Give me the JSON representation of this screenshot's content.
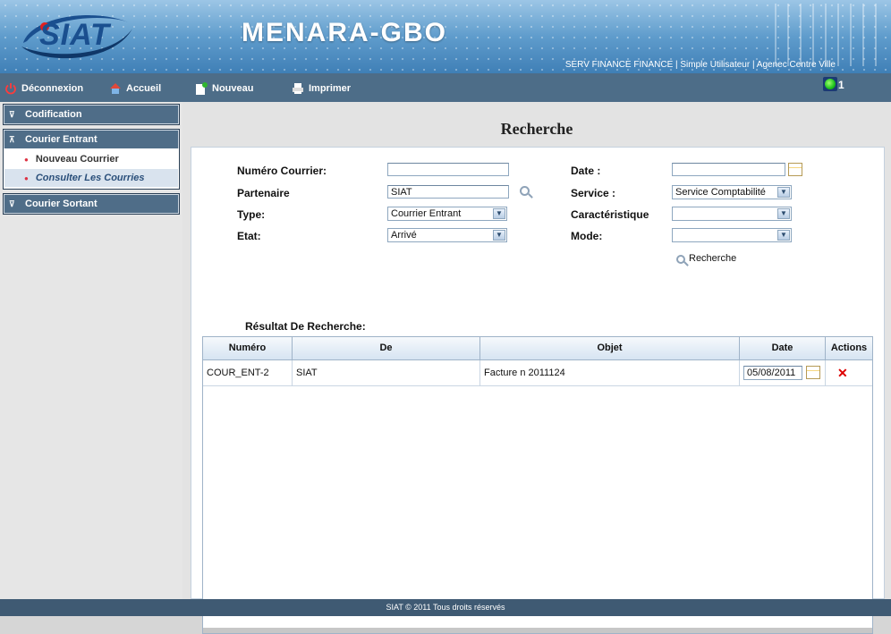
{
  "header": {
    "logo": "SIAT",
    "app_title": "MENARA-GBO",
    "user_info": "SERV FINANCE FINANCE | Simple Utilisateur | Agenec Centre Ville"
  },
  "toolbar": {
    "logout": "Déconnexion",
    "home": "Accueil",
    "new": "Nouveau",
    "print": "Imprimer",
    "notification_count": "1"
  },
  "sidebar": {
    "codification": "Codification",
    "courier_entrant": "Courier Entrant",
    "nouveau_courrier": "Nouveau Courrier",
    "consulter": "Consulter Les Courries",
    "courier_sortant": "Courier Sortant"
  },
  "main": {
    "title": "Recherche",
    "form": {
      "numero_label": "Numéro Courrier:",
      "numero_value": "",
      "partenaire_label": "Partenaire",
      "partenaire_value": "SIAT",
      "type_label": "Type:",
      "type_value": "Courrier Entrant",
      "etat_label": "Etat:",
      "etat_value": "Arrivé",
      "date_label": "Date :",
      "date_value": "",
      "service_label": "Service :",
      "service_value": "Service Comptabilité",
      "caracteristique_label": "Caractéristique",
      "caracteristique_value": "",
      "mode_label": "Mode:",
      "mode_value": "",
      "search_button": "Recherche"
    },
    "results_title": "Résultat De Recherche:",
    "table": {
      "headers": [
        "Numéro",
        "De",
        "Objet",
        "Date",
        "Actions"
      ],
      "rows": [
        {
          "numero": "COUR_ENT-2",
          "de": "SIAT",
          "objet": "Facture n 2011124",
          "date": "05/08/2011"
        }
      ]
    }
  },
  "footer": "SIAT © 2011 Tous droits réservés",
  "colors": {
    "toolbar": "#4d6d88",
    "sidebar_section": "#4f6d88",
    "footer": "#3f5a73",
    "delete": "#dd0000"
  }
}
